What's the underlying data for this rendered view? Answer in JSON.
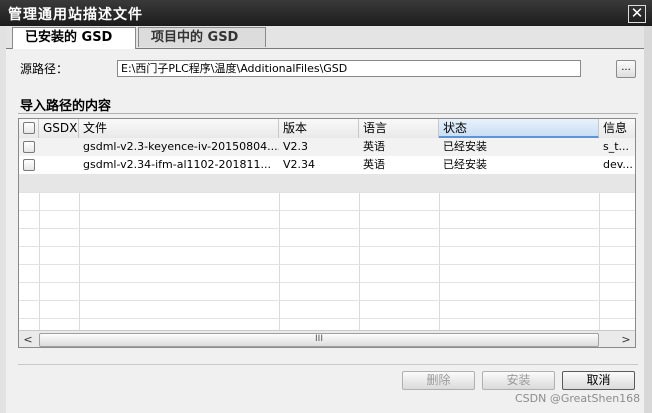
{
  "window": {
    "title": "管理通用站描述文件"
  },
  "tabs": [
    {
      "label": "已安装的 GSD",
      "active": true
    },
    {
      "label": "项目中的 GSD",
      "active": false
    }
  ],
  "source": {
    "label": "源路径：",
    "path": "E:\\西门子PLC程序\\温度\\AdditionalFiles\\GSD",
    "browse_label": "..."
  },
  "content": {
    "title": "导入路径的内容"
  },
  "table": {
    "columns": [
      "GSDX",
      "文件",
      "版本",
      "语言",
      "状态",
      "信息"
    ],
    "rows": [
      {
        "file": "gsdml-v2.3-keyence-iv-20150804....",
        "version": "V2.3",
        "language": "英语",
        "status": "已经安装",
        "info": "s_t..."
      },
      {
        "file": "gsdml-v2.34-ifm-al1102-201811...",
        "version": "V2.34",
        "language": "英语",
        "status": "已经安装",
        "info": "dev..."
      }
    ],
    "scrollbar": {
      "left_arrow": "<",
      "right_arrow": ">",
      "thumb_grip": "III"
    }
  },
  "buttons": {
    "delete": "删除",
    "install": "安装",
    "cancel": "取消"
  },
  "watermark": "CSDN @GreatShen168",
  "colors": {
    "titlebar": "#262626",
    "status_header": "#c9def5",
    "accent": "#5c94d6"
  }
}
